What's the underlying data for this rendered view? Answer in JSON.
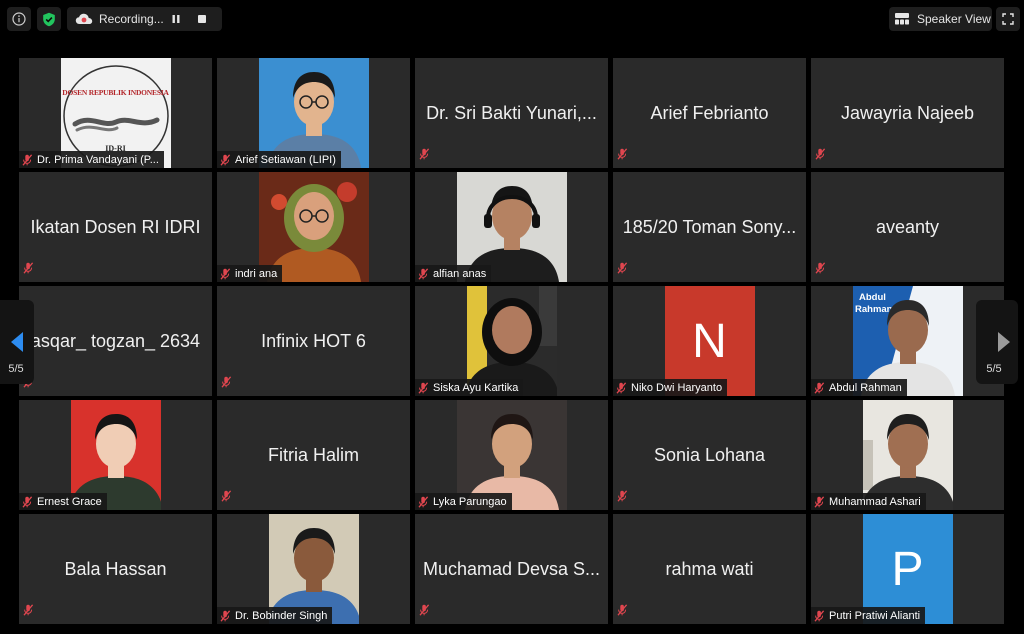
{
  "toolbar": {
    "recording_label": "Recording...",
    "speaker_view_label": "Speaker View"
  },
  "navigation": {
    "left_page": "5/5",
    "right_page": "5/5"
  },
  "participants": [
    {
      "name": "Dr. Prima Vandayani (P...",
      "has_video": true,
      "avatar": "dosen-logo",
      "logo_text": "DOSEN REPUBLIK INDONESIA",
      "logo_sub": "ID-RI"
    },
    {
      "name": "Arief Setiawan (LIPI)",
      "has_video": true,
      "avatar": "photo-arief"
    },
    {
      "name": "Dr. Sri Bakti Yunari,...",
      "has_video": false
    },
    {
      "name": "Arief Febrianto",
      "has_video": false
    },
    {
      "name": "Jawayria Najeeb",
      "has_video": false
    },
    {
      "name": "Ikatan Dosen RI IDRI",
      "has_video": false
    },
    {
      "name": "indri ana",
      "has_video": true,
      "avatar": "photo-indri"
    },
    {
      "name": "alfian anas",
      "has_video": true,
      "avatar": "photo-alfian"
    },
    {
      "name": "185/20 Toman Sony...",
      "has_video": false
    },
    {
      "name": "aveanty",
      "has_video": false
    },
    {
      "name": "asqar_ togzan_ 2634",
      "has_video": false
    },
    {
      "name": "Infinix HOT 6",
      "has_video": false
    },
    {
      "name": "Siska Ayu Kartika",
      "has_video": true,
      "avatar": "photo-siska"
    },
    {
      "name": "Niko Dwi Haryanto",
      "has_video": true,
      "avatar": "letter",
      "letter": "N",
      "color": "#c8392b"
    },
    {
      "name": "Abdul Rahman",
      "has_video": true,
      "avatar": "photo-abdul",
      "overlay_text": "Abdul Rahman"
    },
    {
      "name": "Ernest Grace",
      "has_video": true,
      "avatar": "photo-ernest"
    },
    {
      "name": "Fitria Halim",
      "has_video": false
    },
    {
      "name": "Lyka Parungao",
      "has_video": true,
      "avatar": "photo-lyka"
    },
    {
      "name": "Sonia Lohana",
      "has_video": false
    },
    {
      "name": "Muhammad Ashari",
      "has_video": true,
      "avatar": "photo-ashari"
    },
    {
      "name": "Bala Hassan",
      "has_video": false
    },
    {
      "name": "Dr. Bobinder Singh",
      "has_video": true,
      "avatar": "photo-bobinder"
    },
    {
      "name": "Muchamad Devsa S...",
      "has_video": false
    },
    {
      "name": "rahma wati",
      "has_video": false
    },
    {
      "name": "Putri Pratiwi Alianti",
      "has_video": true,
      "avatar": "letter",
      "letter": "P",
      "color": "#2d8ed6"
    }
  ],
  "colors": {
    "tile_bg": "#2a2a2a",
    "mic_muted": "#e0464f",
    "shield_green": "#22c55e",
    "nav_arrow": "#2d8cf0"
  }
}
